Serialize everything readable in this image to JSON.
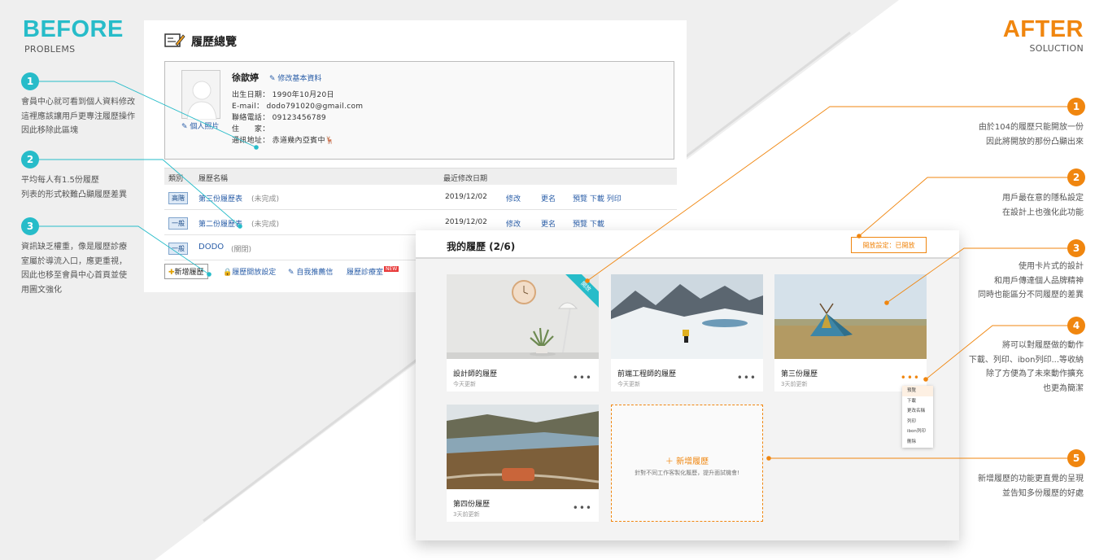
{
  "colors": {
    "teal": "#27bcc9",
    "orange": "#f0860f",
    "link": "#2a5ea8"
  },
  "before": {
    "heading": "BEFORE",
    "subheading": "PROBLEMS",
    "notes": [
      {
        "num": "1",
        "lines": [
          "會員中心就可看到個人資料修改",
          "這裡應該讓用戶更專注履歷操作",
          "因此移除此區塊"
        ]
      },
      {
        "num": "2",
        "lines": [
          "平均每人有1.5份履歷",
          "列表的形式較難凸顯履歷差異"
        ]
      },
      {
        "num": "3",
        "lines": [
          "資訊缺乏權重，像是履歷診療",
          "室屬於導流入口，應更重視，",
          "因此也移至會員中心首頁並使",
          "用圖文強化"
        ]
      }
    ]
  },
  "after": {
    "heading": "AFTER",
    "subheading": "SOLUCTION",
    "notes": [
      {
        "num": "1",
        "lines": [
          "由於104的履歷只能開放一份",
          "因此將開放的那份凸顯出來"
        ]
      },
      {
        "num": "2",
        "lines": [
          "用戶最在意的隱私設定",
          "在設計上也強化此功能"
        ]
      },
      {
        "num": "3",
        "lines": [
          "使用卡片式的設計",
          "和用戶傳達個人品牌精神",
          "同時也能區分不同履歷的差異"
        ]
      },
      {
        "num": "4",
        "lines": [
          "將可以對履歷做的動作",
          "下載、列印、ibon列印...等收納",
          "除了方便為了未來動作擴充",
          "也更為簡潔"
        ]
      },
      {
        "num": "5",
        "lines": [
          "新增履歷的功能更直覺的呈現",
          "並告知多份履歷的好處"
        ]
      }
    ]
  },
  "old_ui": {
    "title": "履歷總覽",
    "profile": {
      "name": "徐歆婷",
      "edit_label": "修改基本資料",
      "photo_label": "個人照片",
      "birth": "出生日期： 1990年10月20日",
      "email": "E-mail： dodo791020@gmail.com",
      "phone": "聯絡電話： 09123456789",
      "home": "住　　家：",
      "address": "通訊地址： 赤道幾內亞賓中🦌"
    },
    "table": {
      "headers": {
        "category": "類別",
        "name": "履歷名稱",
        "date": "最近修改日期"
      },
      "rows": [
        {
          "category": "高階",
          "name": "第三份履歷表",
          "status": "(未完成)",
          "date": "2019/12/02",
          "edit": "修改",
          "rename": "更名",
          "actions": "預覽 下載 列印"
        },
        {
          "category": "一般",
          "name": "第二份履歷表",
          "status": "(未完成)",
          "date": "2019/12/02",
          "edit": "修改",
          "rename": "更名",
          "actions": "預覽 下載"
        },
        {
          "category": "一般",
          "name": "DODO",
          "status": "(關閉)",
          "date": "",
          "edit": "",
          "rename": "",
          "actions": ""
        }
      ]
    },
    "links": {
      "add": "新增履歷",
      "open_setting": "履歷開放設定",
      "recommend": "自我推薦信",
      "clinic": "履歷診療室",
      "new_tag": "NEW"
    }
  },
  "new_ui": {
    "title": "我的履歷 (2/6)",
    "open_setting": "開放設定：已開放",
    "ribbon": "開放",
    "cards": [
      {
        "title": "設計師的履歷",
        "updated": "今天更新",
        "more": "•••"
      },
      {
        "title": "前端工程師的履歷",
        "updated": "今天更新",
        "more": "•••"
      },
      {
        "title": "第三份履歷",
        "updated": "3天前更新",
        "more": "•••"
      },
      {
        "title": "第四份履歷",
        "updated": "3天前更新",
        "more": "•••"
      }
    ],
    "add_card": {
      "title": "＋ 新增履歷",
      "subtitle": "針對不同工作客製化履歷，提升面試機會!"
    },
    "menu": [
      "預覽",
      "下載",
      "更改名稱",
      "列印",
      "ibon列印",
      "刪除"
    ]
  }
}
